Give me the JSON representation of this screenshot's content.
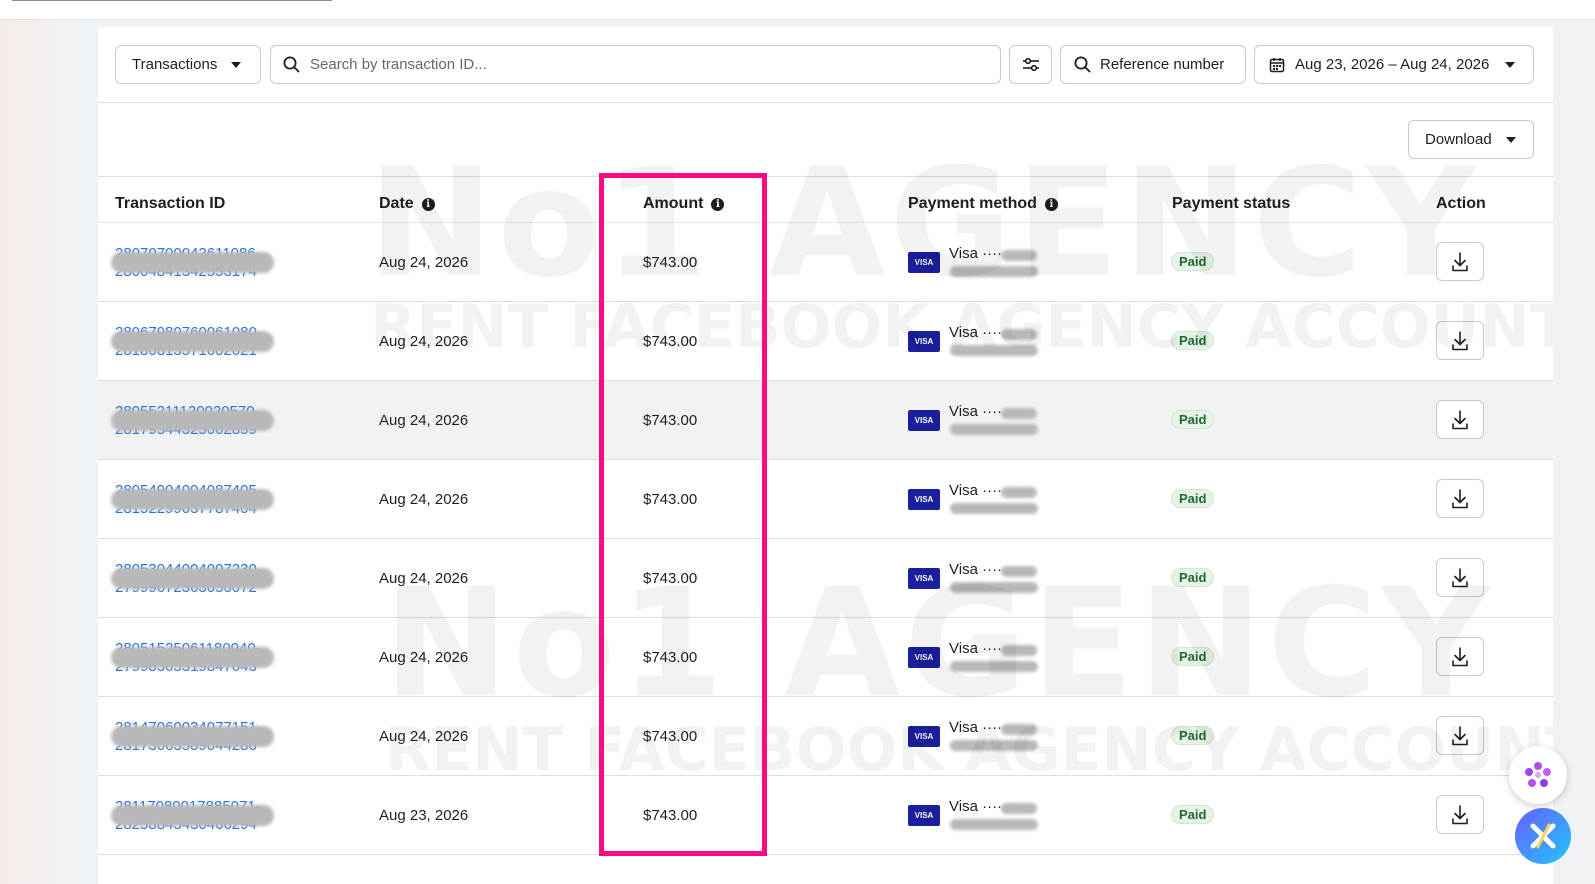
{
  "toolbar": {
    "type_select": "Transactions",
    "search_placeholder": "Search by transaction ID...",
    "reference_button": "Reference number",
    "date_range": "Aug 23, 2026 – Aug 24, 2026"
  },
  "download_label": "Download",
  "columns": [
    "Transaction ID",
    "Date",
    "Amount",
    "Payment method",
    "Payment status",
    "Action"
  ],
  "rows": [
    {
      "id_line1": "28070700042611086-",
      "id_line2": "28004841342553174",
      "date": "Aug 24, 2026",
      "amount": "$743.00",
      "method": "Visa ···· ",
      "status": "Paid"
    },
    {
      "id_line1": "28067980760061080-",
      "id_line2": "28180813571602621",
      "date": "Aug 24, 2026",
      "amount": "$743.00",
      "method": "Visa ···· ",
      "status": "Paid"
    },
    {
      "id_line1": "28055211120020570-",
      "id_line2": "28179544325062859",
      "date": "Aug 24, 2026",
      "amount": "$743.00",
      "method": "Visa ···· ",
      "status": "Paid"
    },
    {
      "id_line1": "28054904004087405-",
      "id_line2": "28152299037787404",
      "date": "Aug 24, 2026",
      "amount": "$743.00",
      "method": "Visa ···· ",
      "status": "Paid"
    },
    {
      "id_line1": "28053044004007230-",
      "id_line2": "27999672363050072",
      "date": "Aug 24, 2026",
      "amount": "$743.00",
      "method": "Visa ···· ",
      "status": "Paid"
    },
    {
      "id_line1": "28051525061180040-",
      "id_line2": "27998365319847643",
      "date": "Aug 24, 2026",
      "amount": "$743.00",
      "method": "Visa ···· ",
      "status": "Paid"
    },
    {
      "id_line1": "28147060034077151-",
      "id_line2": "28173063589044286",
      "date": "Aug 24, 2026",
      "amount": "$743.00",
      "method": "Visa ···· ",
      "status": "Paid"
    },
    {
      "id_line1": "28117080017885071-",
      "id_line2": "28258843430466294",
      "date": "Aug 23, 2026",
      "amount": "$743.00",
      "method": "Visa ···· ",
      "status": "Paid"
    }
  ],
  "card_brand": "VISA",
  "watermark": {
    "title": "No1 AGENCY",
    "subtitle": "RENT FACEBOOK AGENCY ACCOUNT"
  },
  "colors": {
    "link": "#216fdb",
    "highlight": "#ff0a84",
    "visa": "#1a1f9c",
    "paid_bg": "#e7f3e8",
    "paid_text": "#1d6b2e"
  }
}
